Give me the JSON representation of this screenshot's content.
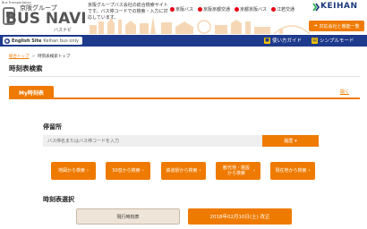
{
  "header": {
    "logo_tag": "Bus Transportation",
    "logo_group": "京阪グループ",
    "logo_main": "BUS NAVI",
    "logo_kana": "バスナビ",
    "description": "京阪グループバス会社の総合検索サイトです。バス停コードでの検索・入力に対応しています。",
    "companies": [
      {
        "label": "京阪バス"
      },
      {
        "label": "京阪京都交通"
      },
      {
        "label": "京都京阪バス"
      },
      {
        "label": "江若交通"
      }
    ],
    "brand": "KEIHAN",
    "inquiry_label": "対応会社と機能一覧"
  },
  "navbar": {
    "english_site": "English Site",
    "english_sub": "Keihan bus only",
    "help_label": "使い方ガイド",
    "simple_label": "シンプルモード"
  },
  "breadcrumb": {
    "home": "総合トップ",
    "current": "時刻表検索トップ"
  },
  "page_title": "時刻表検索",
  "my_timetable": {
    "tab_label": "My時刻表",
    "open_label": "開く"
  },
  "stop_search": {
    "title": "停留所",
    "placeholder": "バス停名またはバス停コードを入力",
    "history_label": "履歴",
    "buttons": [
      {
        "label": "地図から検索"
      },
      {
        "label": "50音から検索"
      },
      {
        "label": "鉄道駅から検索"
      },
      {
        "label": "観光地・施設から検索"
      },
      {
        "label": "現在地から検索"
      }
    ]
  },
  "timetable_select": {
    "title": "時刻表選択",
    "current_label": "現行時刻表",
    "revised_label": "2018年02月10日(土) 改正"
  },
  "colors": {
    "accent": "#ef7a00",
    "navy": "#1e3a8c",
    "brand_red": "#e60012"
  }
}
